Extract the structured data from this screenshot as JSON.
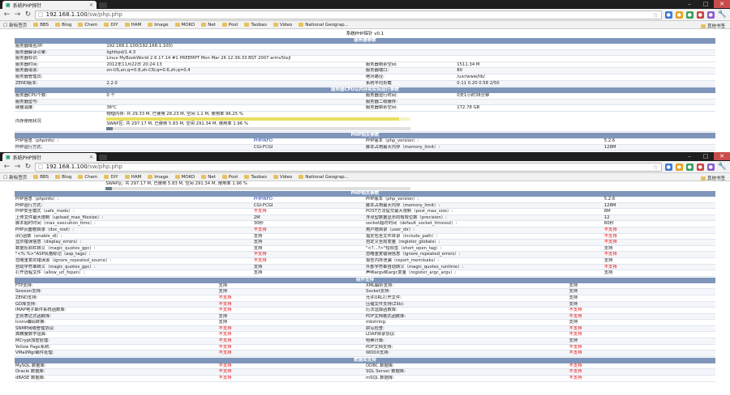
{
  "browser": {
    "tab_title": "系统PHP探针",
    "url_host": "192.168.1.100",
    "url_path": "/sw/php.php",
    "bookmarks": [
      "新标签页",
      "BBS",
      "Blog",
      "Chem",
      "DIY",
      "HAM",
      "Image",
      "MOKO",
      "Net",
      "Post",
      "Taobao",
      "Video",
      "National Geograp..."
    ],
    "other_bookmarks": "其他书签",
    "icons": [
      "back-icon",
      "forward-icon",
      "reload-icon",
      "star-icon",
      "wrench-icon"
    ]
  },
  "page_title": "系统PHP探针 v0.1",
  "sections": {
    "server": "服务器参数",
    "cpu": "服务器CPU以内存和实际运行参数",
    "php": "PHP相关参数",
    "components": "组件支持",
    "database": "数据库支持"
  },
  "server_rows": [
    {
      "label": "服务器域名/IP:",
      "value": "192.168.1.100(192.168.1.100)"
    },
    {
      "label": "服务器解译引擎:",
      "value": "lighttpd/1.4.3"
    },
    {
      "label": "服务器标识:",
      "value": "Linux MyBookWorld 2.6.17.14 #1 PREEMPT Mon Mar 26 12:36:33 BST 2007 armv5tejl"
    }
  ],
  "server_pairs": [
    [
      "服务器时间:",
      "2012年11月22日 20:24:13",
      "服务器剩余空间:",
      "1511.34 M"
    ],
    [
      "服务器语言:",
      "en-US,en;q=0.8,zh-CN;q=0.6,zh;q=0.4",
      "服务器端口:",
      "80"
    ],
    [
      "服务器管理员:",
      "",
      "绝对路径:",
      "/usr/www/lib/"
    ],
    [
      "ZEND版本:",
      "2.2.0",
      "系统平均负载",
      "0.11 0.20 0.58 2/50"
    ]
  ],
  "cpu_pairs": [
    [
      "服务器CPU个数:",
      "0 个",
      "服务器运行时间:",
      "0天1小时38分钟"
    ],
    [
      "服务器型号:",
      "",
      "服务器二级缓存:",
      ""
    ],
    [
      "硬盘温度:",
      "36℃",
      "服务器剩余空间:",
      "172.78 GB"
    ]
  ],
  "memory": {
    "label": "内存使用状况",
    "physical": "物理内存: 共 29.33 M, 已使用 28.23 M, 空闲 1.1 M, 使用率 96.25 %",
    "physical_pct": 96.25,
    "swap": "SWAP区: 共 297.17 M, 已使用 5.83 M, 空闲 291.34 M, 使用率 1.96 %",
    "swap_pct": 1.96
  },
  "php_rows_top": [
    [
      "PHP信息（phpinfo）:",
      "PHPINFO",
      "PHP版本（php_version）:",
      "5.2.6"
    ],
    [
      "PHP运行方式:",
      "CGI-FCGI",
      "脚本占用最大内存（memory_limit）:",
      "128M"
    ]
  ],
  "php_rows": [
    [
      "PHP信息（phpinfo）:",
      "PHPINFO",
      "PHP版本（php_version）:",
      "5.2.6"
    ],
    [
      "PHP运行方式:",
      "CGI-FCGI",
      "脚本占用最大内存（memory_limit）:",
      "128M"
    ],
    [
      "PHP安全模式（safe_mode）:",
      "不支持",
      "POST方法提交最大限制（post_max_size）:",
      "8M"
    ],
    [
      "上传文件最大限制（upload_max_filesize）:",
      "2M",
      "浮点型数据显示的有效位数（precision）:",
      "12"
    ],
    [
      "脚本超时时间（max_execution_time）:",
      "30秒",
      "socket超时时间（default_socket_timeout）:",
      "60秒"
    ],
    [
      "PHP页面根目录（doc_root）:",
      "不支持",
      "用户根目录（user_dir）:",
      "不支持"
    ],
    [
      "dl()函数（enable_dl）:",
      "支持",
      "指定包含文件目录（include_path）:",
      "不支持"
    ],
    [
      "显示错误信息（display_errors）:",
      "支持",
      "自定义全局变量（register_globals）:",
      "不支持"
    ],
    [
      "数据反斜杠转义（magic_quotes_gpc）:",
      "支持",
      "\"<?...?>\"短标签（short_open_tag）:",
      "支持"
    ],
    [
      "\"<% %>\"ASP风格标记（asp_tags）:",
      "不支持",
      "忽略重复错误信息（ignore_repeated_errors）:",
      "不支持"
    ],
    [
      "忽略重复的错误源（ignore_repeated_source）:",
      "不支持",
      "报告内存泄漏（report_memleaks）:",
      "支持"
    ],
    [
      "自动字符串转义（magic_quotes_gpc）:",
      "支持",
      "外部字符串自动转义（magic_quotes_runtime）:",
      "不支持"
    ],
    [
      "打开远程文件（allow_url_fopen）:",
      "支持",
      "声明argv和argc变量（register_argc_argv）:",
      "支持"
    ]
  ],
  "component_rows": [
    [
      "FTP支持:",
      "支持",
      "XML解析支持:",
      "支持"
    ],
    [
      "Session支持:",
      "支持",
      "Socket支持:",
      "支持"
    ],
    [
      "ZEND支持:",
      "不支持",
      "允许URL打开文件:",
      "支持"
    ],
    [
      "GD库支持:",
      "不支持",
      "压缩文件支持(Zlib):",
      "支持"
    ],
    [
      "IMAP电子邮件系统函数库:",
      "不支持",
      "历法运算函数库:",
      "不支持"
    ],
    [
      "正则表达式函数库:",
      "支持",
      "PDF文档格式函数库:",
      "不支持"
    ],
    [
      "Iconv编码转换:",
      "支持",
      "mbstring:",
      "支持"
    ],
    [
      "SNMP网络管理协议:",
      "不支持",
      "拼写检查:",
      "不支持"
    ],
    [
      "高精度数学运算:",
      "不支持",
      "LDAP目录协议:",
      "不支持"
    ],
    [
      "MCrypt加密处理:",
      "不支持",
      "哈稀计算:",
      "支持"
    ],
    [
      "Yellow Page系统:",
      "不支持",
      "PDF文档支持:",
      "不支持"
    ],
    [
      "VMailMgr邮件处理:",
      "不支持",
      "WDDX支持:",
      "不支持"
    ]
  ],
  "database_rows": [
    [
      "MySQL 数据库:",
      "不支持",
      "ODBC 数据库:",
      "不支持"
    ],
    [
      "Oracle 数据库:",
      "不支持",
      "SQL Server 数据库:",
      "不支持"
    ],
    [
      "dBASE 数据库:",
      "不支持",
      "mSQL 数据库:",
      "不支持"
    ]
  ],
  "no_support_text": "不支持"
}
